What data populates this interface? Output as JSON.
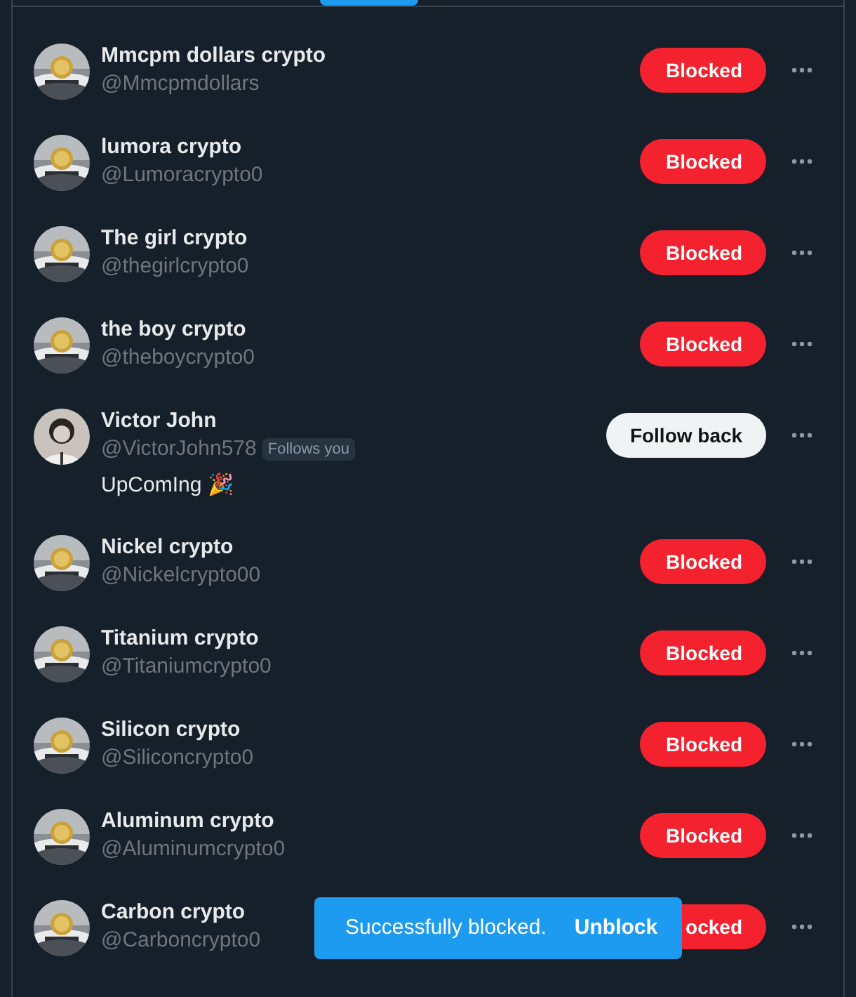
{
  "users": [
    {
      "name": "Mmcpm dollars crypto",
      "handle": "@Mmcpmdollars",
      "button": {
        "kind": "blocked",
        "label": "Blocked"
      }
    },
    {
      "name": "lumora crypto",
      "handle": "@Lumoracrypto0",
      "button": {
        "kind": "blocked",
        "label": "Blocked"
      }
    },
    {
      "name": "The girl crypto",
      "handle": "@thegirlcrypto0",
      "button": {
        "kind": "blocked",
        "label": "Blocked"
      }
    },
    {
      "name": "the boy crypto",
      "handle": "@theboycrypto0",
      "button": {
        "kind": "blocked",
        "label": "Blocked"
      }
    },
    {
      "name": "Victor John",
      "handle": "@VictorJohn578",
      "follows_you": "Follows you",
      "bio": "UpComIng 🎉",
      "button": {
        "kind": "follow",
        "label": "Follow back"
      }
    },
    {
      "name": "Nickel crypto",
      "handle": "@Nickelcrypto00",
      "button": {
        "kind": "blocked",
        "label": "Blocked"
      }
    },
    {
      "name": "Titanium crypto",
      "handle": "@Titaniumcrypto0",
      "button": {
        "kind": "blocked",
        "label": "Blocked"
      }
    },
    {
      "name": "Silicon crypto",
      "handle": "@Siliconcrypto0",
      "button": {
        "kind": "blocked",
        "label": "Blocked"
      }
    },
    {
      "name": "Aluminum crypto",
      "handle": "@Aluminumcrypto0",
      "button": {
        "kind": "blocked",
        "label": "Blocked"
      }
    },
    {
      "name": "Carbon crypto",
      "handle": "@Carboncrypto0",
      "button": {
        "kind": "blocked",
        "label": "ocked"
      }
    }
  ],
  "toast": {
    "message": "Successfully blocked.",
    "action": "Unblock"
  }
}
